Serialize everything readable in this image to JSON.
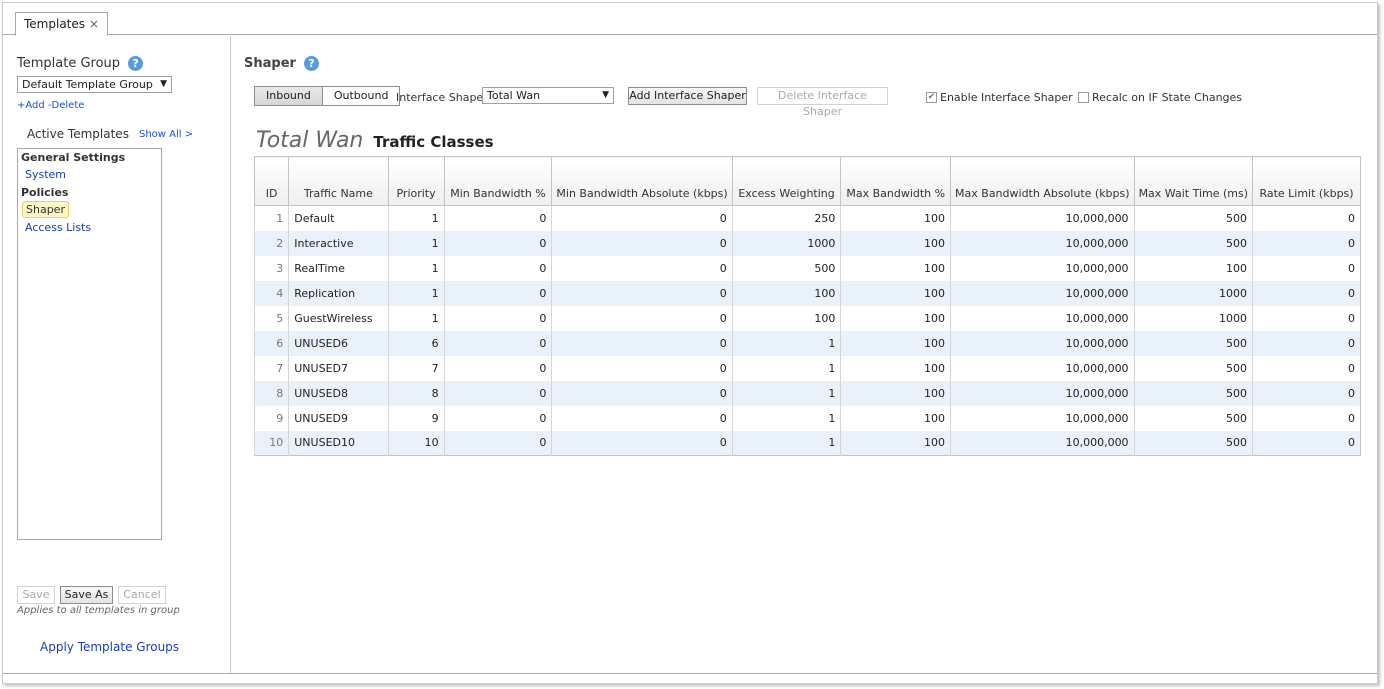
{
  "tabs": [
    {
      "label": "Templates",
      "close": "×"
    }
  ],
  "left": {
    "template_group_label": "Template Group",
    "help": "?",
    "template_group_value": "Default Template Group",
    "select_arrow": "▼",
    "add_label": "+Add",
    "delete_label": "-Delete",
    "active_templates_label": "Active Templates",
    "show_all_label": "Show All >",
    "tree": {
      "general_settings": "General Settings",
      "system": "System",
      "policies": "Policies",
      "shaper": "Shaper",
      "access_lists": "Access Lists"
    },
    "buttons": {
      "save": "Save",
      "save_as": "Save As",
      "cancel": "Cancel"
    },
    "applies_text": "Applies to all templates in group",
    "apply_groups_label": "Apply Template Groups"
  },
  "main": {
    "title": "Shaper",
    "help": "?",
    "inbound_label": "Inbound",
    "outbound_label": "Outbound",
    "interface_shaper_label": "Interface Shaper",
    "interface_shaper_value": "Total Wan",
    "select_arrow": "▼",
    "add_interface_shaper": "Add Interface Shaper",
    "delete_interface_shaper": "Delete Interface Shaper",
    "enable_interface_shaper": {
      "label": "Enable Interface Shaper",
      "checked": true,
      "mark": "✔"
    },
    "recalc_on_if_state": {
      "label": "Recalc on IF State Changes",
      "checked": false
    },
    "section_title": "Total Wan",
    "section_subtitle": "Traffic Classes",
    "columns": [
      "ID",
      "Traffic Name",
      "Priority",
      "Min Bandwidth %",
      "Min Bandwidth Absolute (kbps)",
      "Excess Weighting",
      "Max Bandwidth %",
      "Max Bandwidth Absolute (kbps)",
      "Max Wait Time (ms)",
      "Rate Limit (kbps)"
    ],
    "rows": [
      [
        "1",
        "Default",
        "1",
        "0",
        "0",
        "250",
        "100",
        "10,000,000",
        "500",
        "0"
      ],
      [
        "2",
        "Interactive",
        "1",
        "0",
        "0",
        "1000",
        "100",
        "10,000,000",
        "500",
        "0"
      ],
      [
        "3",
        "RealTime",
        "1",
        "0",
        "0",
        "500",
        "100",
        "10,000,000",
        "100",
        "0"
      ],
      [
        "4",
        "Replication",
        "1",
        "0",
        "0",
        "100",
        "100",
        "10,000,000",
        "1000",
        "0"
      ],
      [
        "5",
        "GuestWireless",
        "1",
        "0",
        "0",
        "100",
        "100",
        "10,000,000",
        "1000",
        "0"
      ],
      [
        "6",
        "UNUSED6",
        "6",
        "0",
        "0",
        "1",
        "100",
        "10,000,000",
        "500",
        "0"
      ],
      [
        "7",
        "UNUSED7",
        "7",
        "0",
        "0",
        "1",
        "100",
        "10,000,000",
        "500",
        "0"
      ],
      [
        "8",
        "UNUSED8",
        "8",
        "0",
        "0",
        "1",
        "100",
        "10,000,000",
        "500",
        "0"
      ],
      [
        "9",
        "UNUSED9",
        "9",
        "0",
        "0",
        "1",
        "100",
        "10,000,000",
        "500",
        "0"
      ],
      [
        "10",
        "UNUSED10",
        "10",
        "0",
        "0",
        "1",
        "100",
        "10,000,000",
        "500",
        "0"
      ]
    ]
  }
}
